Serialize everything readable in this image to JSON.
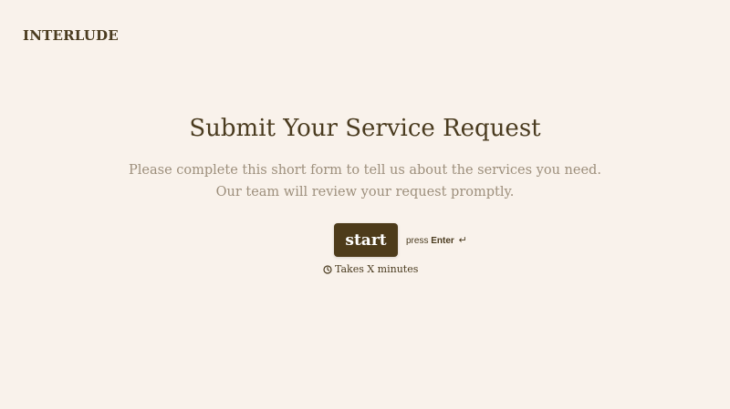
{
  "brand": {
    "logo_text": "INTERLUDE"
  },
  "welcome": {
    "title": "Submit Your Service Request",
    "description": "Please complete this short form to tell us about the services you need. Our team will review your request promptly."
  },
  "actions": {
    "start_label": "start",
    "hint_prefix": "press",
    "hint_key": "Enter",
    "hint_symbol": "↵",
    "duration_text": "Takes X minutes",
    "duration_icon": "clock-icon"
  },
  "colors": {
    "background": "#f9f2eb",
    "primary": "#4d3b1a",
    "text": "#4a3b1f",
    "muted_text": "#9d8f7c"
  }
}
